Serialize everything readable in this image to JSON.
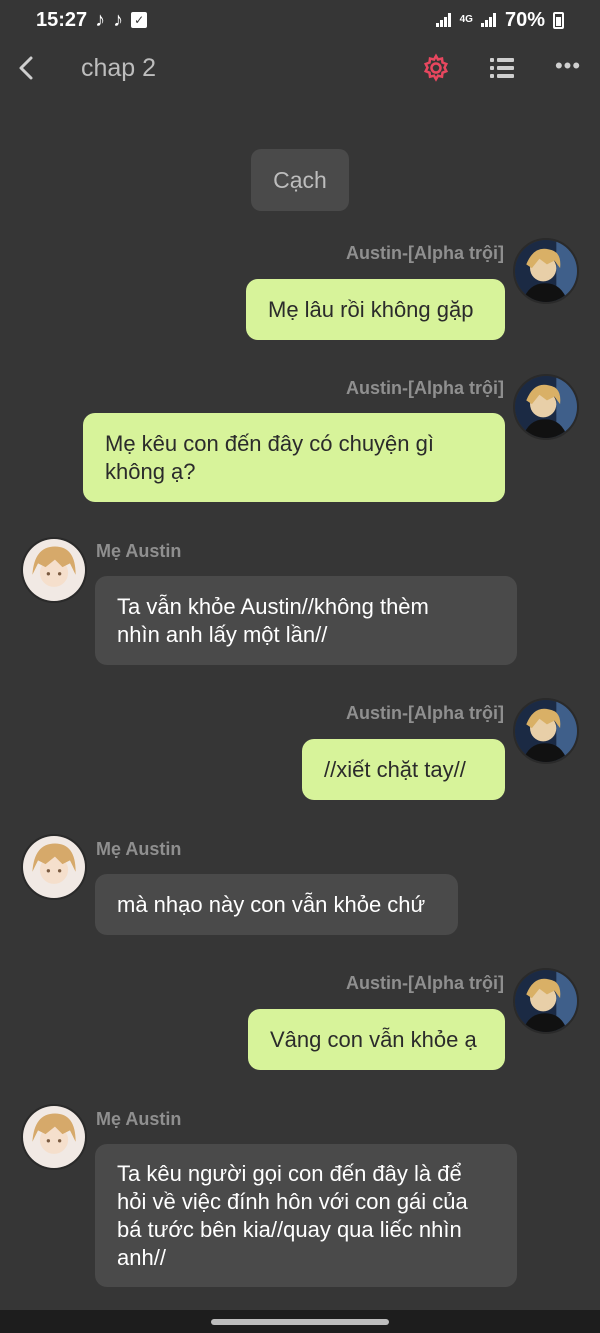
{
  "status_bar": {
    "time": "15:27",
    "network": "4G",
    "battery": "70%",
    "icons": [
      "tiktok-icon",
      "tiktok-icon",
      "check-icon",
      "signal-icon",
      "signal-icon",
      "battery-icon"
    ]
  },
  "header": {
    "title": "chap 2",
    "icons": [
      "back-icon",
      "gear-icon",
      "list-icon",
      "more-icon"
    ],
    "accent_color": "#e8475f"
  },
  "scene_label": "Cạch",
  "messages": [
    {
      "side": "out",
      "sender": "Austin-[Alpha trội]",
      "lines": [
        "Mẹ lâu rồi không gặp"
      ]
    },
    {
      "side": "out",
      "sender": "Austin-[Alpha trội]",
      "lines": [
        "Mẹ kêu con đến đây có chuyện gì",
        "không ạ?"
      ]
    },
    {
      "side": "in",
      "sender": "Mẹ Austin",
      "lines": [
        "Ta vẫn khỏe Austin//không thèm",
        "nhìn anh lấy một lần//"
      ]
    },
    {
      "side": "out",
      "sender": "Austin-[Alpha trội]",
      "lines": [
        "//xiết chặt tay//"
      ]
    },
    {
      "side": "in",
      "sender": "Mẹ Austin",
      "lines": [
        "mà nhạo này con vẫn khỏe chứ"
      ]
    },
    {
      "side": "out",
      "sender": "Austin-[Alpha trội]",
      "lines": [
        "Vâng con vẫn khỏe ạ"
      ]
    },
    {
      "side": "in",
      "sender": "Mẹ Austin",
      "lines": [
        "Ta kêu người gọi con đến đây là để",
        "hỏi về việc đính hôn với con gái của",
        "bá tước bên kia//quay qua liếc nhìn",
        "anh//"
      ]
    }
  ],
  "colors": {
    "background": "#363636",
    "outgoing_bubble": "#d7f39a",
    "incoming_bubble": "#4a4a4a"
  }
}
